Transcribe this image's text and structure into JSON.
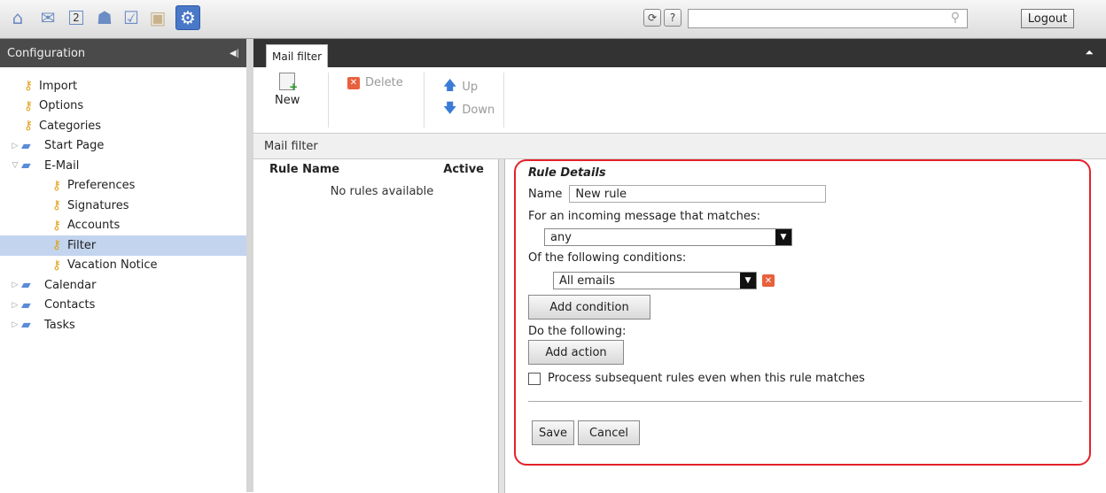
{
  "topbar": {
    "logout_label": "Logout",
    "search_placeholder": "",
    "app_icons": [
      "home-icon",
      "mail-icon",
      "calendar-icon",
      "contacts-icon",
      "tasks-icon",
      "infostore-icon",
      "settings-icon"
    ],
    "calendar_day": "2",
    "help_label": "?"
  },
  "leftpanel": {
    "title": "Configuration",
    "items": [
      {
        "label": "Import",
        "level": 1,
        "kind": "key"
      },
      {
        "label": "Options",
        "level": 1,
        "kind": "key"
      },
      {
        "label": "Categories",
        "level": 1,
        "kind": "key"
      },
      {
        "label": "Start Page",
        "level": 0,
        "kind": "folder",
        "expanded": false
      },
      {
        "label": "E-Mail",
        "level": 0,
        "kind": "folder",
        "expanded": true
      },
      {
        "label": "Preferences",
        "level": 2,
        "kind": "key"
      },
      {
        "label": "Signatures",
        "level": 2,
        "kind": "key"
      },
      {
        "label": "Accounts",
        "level": 2,
        "kind": "key"
      },
      {
        "label": "Filter",
        "level": 2,
        "kind": "key",
        "selected": true
      },
      {
        "label": "Vacation Notice",
        "level": 2,
        "kind": "key"
      },
      {
        "label": "Calendar",
        "level": 0,
        "kind": "folder",
        "expanded": false
      },
      {
        "label": "Contacts",
        "level": 0,
        "kind": "folder",
        "expanded": false
      },
      {
        "label": "Tasks",
        "level": 0,
        "kind": "folder",
        "expanded": false
      }
    ]
  },
  "main": {
    "tab_label": "Mail filter",
    "ribbon": {
      "new_label": "New",
      "delete_label": "Delete",
      "up_label": "Up",
      "down_label": "Down"
    },
    "subheader": "Mail filter",
    "rules": {
      "col_name": "Rule Name",
      "col_active": "Active",
      "empty_text": "No rules available"
    },
    "details": {
      "title": "Rule Details",
      "name_label": "Name",
      "name_value": "New rule",
      "match_label": "For an incoming message that matches:",
      "match_value": "any",
      "conditions_label": "Of the following conditions:",
      "condition_value": "All emails",
      "add_condition_label": "Add condition",
      "actions_label": "Do the following:",
      "add_action_label": "Add action",
      "subsequent_label": "Process subsequent rules even when this rule matches",
      "subsequent_checked": false,
      "save_label": "Save",
      "cancel_label": "Cancel"
    }
  },
  "colors": {
    "highlight_border": "#e4212a",
    "selected_row": "#c2d4ee",
    "header_dark": "#4a4a4a"
  }
}
